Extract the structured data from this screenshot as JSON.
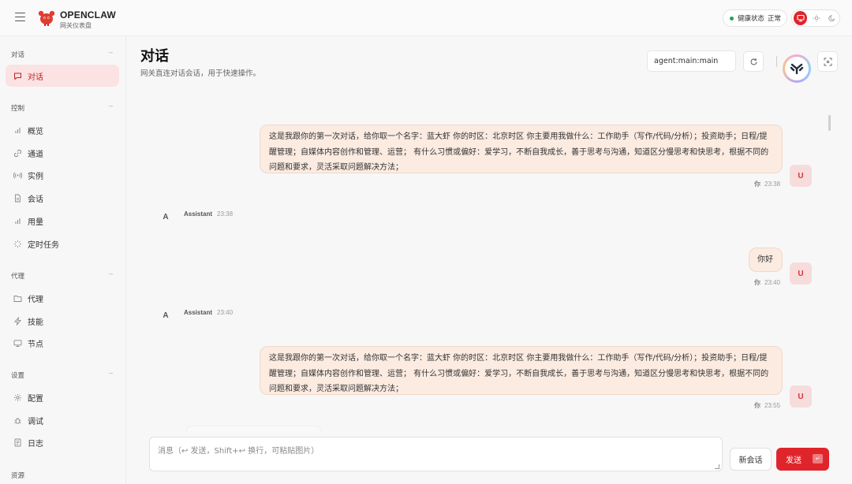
{
  "brand": {
    "name": "OPENCLAW",
    "subtitle": "网关仪表盘"
  },
  "status": {
    "label": "健康状态",
    "value": "正常",
    "color": "#22a45a"
  },
  "theme": {
    "options": [
      "monitor-icon",
      "sun-icon",
      "moon-icon"
    ],
    "active": "monitor-icon",
    "accent": "#e0242b"
  },
  "sidebar": {
    "sections": [
      {
        "title": "对话",
        "items": [
          {
            "label": "对话",
            "icon": "chat-icon",
            "active": true
          }
        ]
      },
      {
        "title": "控制",
        "items": [
          {
            "label": "概览",
            "icon": "bar-chart-icon"
          },
          {
            "label": "通道",
            "icon": "link-icon"
          },
          {
            "label": "实例",
            "icon": "radio-icon"
          },
          {
            "label": "会话",
            "icon": "document-icon"
          },
          {
            "label": "用量",
            "icon": "bar-chart-icon"
          },
          {
            "label": "定时任务",
            "icon": "loader-icon"
          }
        ]
      },
      {
        "title": "代理",
        "items": [
          {
            "label": "代理",
            "icon": "folder-icon"
          },
          {
            "label": "技能",
            "icon": "bolt-icon"
          },
          {
            "label": "节点",
            "icon": "monitor-icon"
          }
        ]
      },
      {
        "title": "设置",
        "items": [
          {
            "label": "配置",
            "icon": "gear-icon"
          },
          {
            "label": "调试",
            "icon": "bug-icon"
          },
          {
            "label": "日志",
            "icon": "log-icon"
          }
        ]
      },
      {
        "title": "资源",
        "items": []
      }
    ]
  },
  "page": {
    "title": "对话",
    "subtitle": "网关直连对话会话，用于快速操作。"
  },
  "session": {
    "value": "agent:main:main"
  },
  "messages": [
    {
      "role": "user",
      "text": "这是我跟你的第一次对话，给你取一个名字：蓝大虾 你的时区：北京时区 你主要用我做什么：工作助手（写作/代码/分析）；投资助手；日程/提醒管理；自媒体内容创作和管理、运营； 有什么习惯或偏好：爱学习，不断自我成长，善于思考与沟通，知道区分慢思考和快思考，根据不同的问题和要求，灵活采取问题解决方法；",
      "lines": [
        "这是我跟你的第一次对话，给你取一个名字：蓝大虾 你的时区：北京时区 你主要用我做什么：工作助手（写作/代码/分析）；投资助手；日程/提",
        "醒管理；自媒体内容创作和管理、运营； 有什么习惯或偏好：爱学习，不断自我成长，善于思考与沟通，知道区分慢思考和快思考，根据不同的",
        "问题和要求，灵活采取问题解决方法；"
      ],
      "sender": "你",
      "time": "23:38",
      "avatar": "U"
    },
    {
      "role": "assistant",
      "sender": "Assistant",
      "time": "23:38",
      "avatar": "A"
    },
    {
      "role": "user",
      "text": "你好",
      "lines": [
        "你好"
      ],
      "sender": "你",
      "time": "23:40",
      "avatar": "U"
    },
    {
      "role": "assistant",
      "sender": "Assistant",
      "time": "23:40",
      "avatar": "A"
    },
    {
      "role": "user",
      "text": "这是我跟你的第一次对话，给你取一个名字：蓝大虾 你的时区：北京时区 你主要用我做什么：工作助手（写作/代码/分析）；投资助手；日程/提醒管理；自媒体内容创作和管理、运营； 有什么习惯或偏好：爱学习，不断自我成长，善于思考与沟通，知道区分慢思考和快思考，根据不同的问题和要求，灵活采取问题解决方法；",
      "lines": [
        "这是我跟你的第一次对话，给你取一个名字：蓝大虾 你的时区：北京时区 你主要用我做什么：工作助手（写作/代码/分析）；投资助手；日程/提",
        "醒管理；自媒体内容创作和管理、运营； 有什么习惯或偏好：爱学习，不断自我成长，善于思考与沟通，知道区分慢思考和快思考，根据不同的",
        "问题和要求，灵活采取问题解决方法；"
      ],
      "sender": "你",
      "time": "23:55",
      "avatar": "U"
    }
  ],
  "composer": {
    "placeholder": "消息（↩ 发送，Shift+↩ 换行，可粘贴图片）",
    "new_chat": "新会话",
    "send": "发送"
  }
}
